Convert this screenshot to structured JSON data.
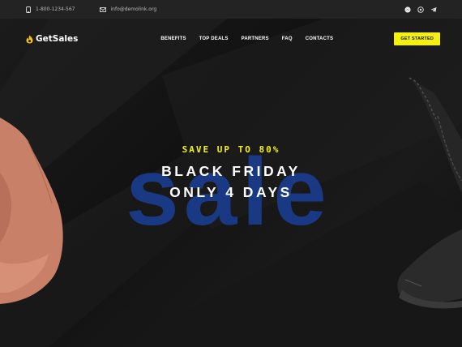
{
  "topbar": {
    "phone": "1-800-1234-567",
    "email": "info@demolink.org",
    "social_icons": [
      "messenger-icon",
      "whatsapp-icon",
      "telegram-icon"
    ]
  },
  "nav": {
    "brand": "GetSales",
    "items": [
      "BENEFITS",
      "TOP DEALS",
      "PARTNERS",
      "FAQ",
      "CONTACTS"
    ],
    "cta": "GET STARTED"
  },
  "hero": {
    "big_word": "sale",
    "promo": "SAVE UP TO 80%",
    "headline_line1": "BLACK FRIDAY",
    "headline_line2": "ONLY 4 DAYS"
  },
  "colors": {
    "accent": "#f4f111",
    "big_word": "#1b3e93",
    "background": "#161616",
    "topbar": "#232323"
  }
}
